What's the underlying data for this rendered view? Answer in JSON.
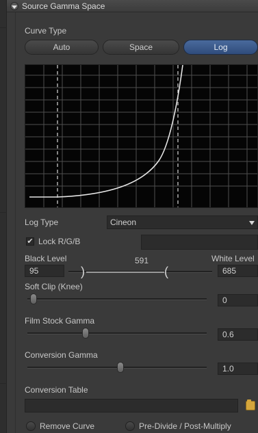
{
  "header": {
    "title": "Source Gamma Space"
  },
  "curve_type": {
    "label": "Curve Type",
    "options": [
      "Auto",
      "Space",
      "Log"
    ],
    "selected": "Log"
  },
  "log_type": {
    "label": "Log Type",
    "value": "Cineon"
  },
  "lock_rgb": {
    "label": "Lock R/G/B",
    "checked": true
  },
  "black_level": {
    "label": "Black Level",
    "value": "95"
  },
  "white_level": {
    "label": "White Level",
    "value": "685"
  },
  "range_readout": "591",
  "soft_clip": {
    "label": "Soft Clip (Knee)",
    "value": "0"
  },
  "film_stock_gamma": {
    "label": "Film Stock Gamma",
    "value": "0.6"
  },
  "conversion_gamma": {
    "label": "Conversion Gamma",
    "value": "1.0"
  },
  "conversion_table": {
    "label": "Conversion Table",
    "value": ""
  },
  "remove_curve": {
    "label": "Remove Curve"
  },
  "pre_divide": {
    "label": "Pre-Divide / Post-Multiply"
  },
  "colors": {
    "accent": "#3b5c8f",
    "curve": "#e6e6e6",
    "grid": "#4e4e4e"
  }
}
